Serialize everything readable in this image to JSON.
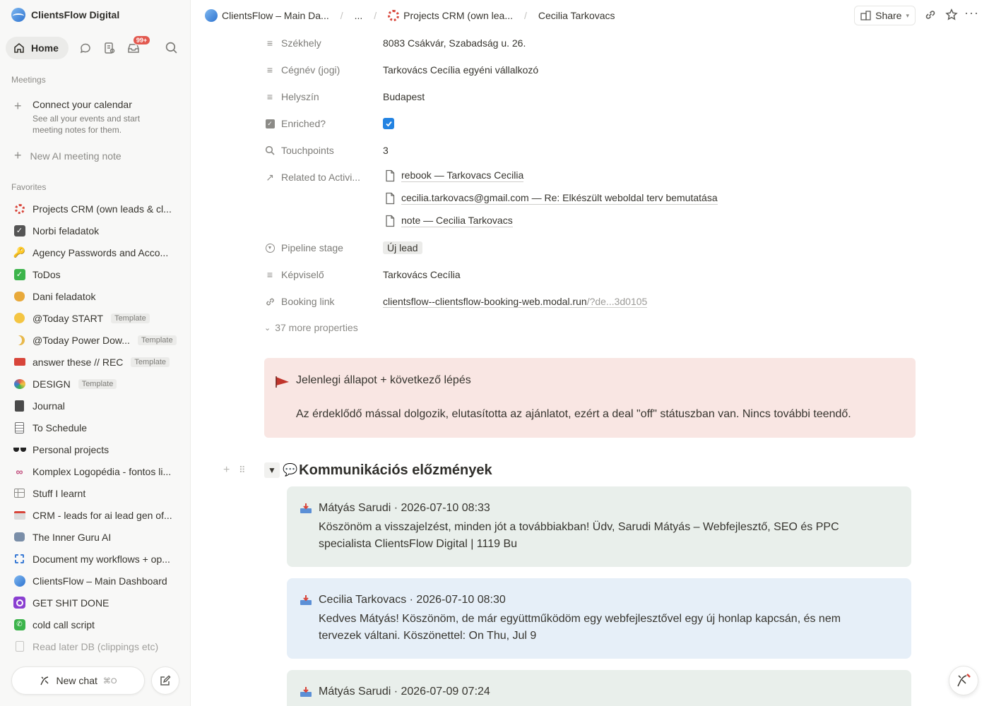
{
  "sidebar": {
    "workspace_name": "ClientsFlow Digital",
    "home_label": "Home",
    "inbox_badge": "99+",
    "meetings_title": "Meetings",
    "connect_calendar_title": "Connect your calendar",
    "connect_calendar_desc": "See all your events and start meeting notes for them.",
    "new_ai_meeting_note": "New AI meeting note",
    "favorites_title": "Favorites",
    "favorites": [
      {
        "label": "Projects CRM (own leads & cl...",
        "icon": "crm-dots-icon"
      },
      {
        "label": "Norbi feladatok",
        "icon": "checkbox-icon"
      },
      {
        "label": "Agency Passwords and Acco...",
        "icon": "key-icon"
      },
      {
        "label": "ToDos",
        "icon": "green-check-icon"
      },
      {
        "label": "Dani feladatok",
        "icon": "cat-icon"
      },
      {
        "label": "@Today START",
        "icon": "smile-icon",
        "template": "Template"
      },
      {
        "label": "@Today Power Dow...",
        "icon": "moon-icon",
        "template": "Template"
      },
      {
        "label": "answer these // REC",
        "icon": "video-camera-icon",
        "template": "Template"
      },
      {
        "label": "DESIGN",
        "icon": "palette-icon",
        "template": "Template"
      },
      {
        "label": "Journal",
        "icon": "notebook-icon"
      },
      {
        "label": "To Schedule",
        "icon": "document-list-icon"
      },
      {
        "label": "Personal projects",
        "icon": "sunglasses-icon"
      },
      {
        "label": "Komplex Logopédia - fontos li...",
        "icon": "link-icon"
      },
      {
        "label": "Stuff I learnt",
        "icon": "table-icon"
      },
      {
        "label": "CRM - leads for ai lead gen of...",
        "icon": "envelope-icon"
      },
      {
        "label": "The Inner Guru AI",
        "icon": "robot-icon"
      },
      {
        "label": "Document my workflows + op...",
        "icon": "chip-icon"
      },
      {
        "label": "ClientsFlow – Main Dashboard",
        "icon": "clientsflow-logo-icon"
      },
      {
        "label": "GET SHIT DONE",
        "icon": "purple-eye-icon"
      },
      {
        "label": "cold call script",
        "icon": "phone-icon"
      },
      {
        "label": "Read later DB (clippings etc)",
        "icon": "clipboard-icon"
      }
    ],
    "new_chat_label": "New chat",
    "new_chat_shortcut": "⌘O"
  },
  "topbar": {
    "breadcrumb_1": "ClientsFlow – Main Da...",
    "breadcrumb_ellipsis": "...",
    "breadcrumb_2": "Projects CRM (own lea...",
    "breadcrumb_3": "Cecilia Tarkovacs",
    "share_label": "Share"
  },
  "properties": {
    "szekhely": {
      "name": "Székhely",
      "value": "8083 Csákvár, Szabadság u. 26."
    },
    "cegnev": {
      "name": "Cégnév (jogi)",
      "value": "Tarkovács Cecília egyéni vállalkozó"
    },
    "helyszin": {
      "name": "Helyszín",
      "value": "Budapest"
    },
    "enriched": {
      "name": "Enriched?",
      "checked": true
    },
    "touchpoints": {
      "name": "Touchpoints",
      "value": "3"
    },
    "related": {
      "name": "Related to Activi...",
      "items": [
        "rebook — Tarkovacs Cecilia",
        "cecilia.tarkovacs@gmail.com — Re: Elkészült weboldal terv bemutatása",
        "note — Cecilia Tarkovacs"
      ]
    },
    "pipeline": {
      "name": "Pipeline stage",
      "value": "Új lead"
    },
    "kepviselo": {
      "name": "Képviselő",
      "value": "Tarkovács Cecília"
    },
    "booking": {
      "name": "Booking link",
      "value": "clientsflow--clientsflow-booking-web.modal.run",
      "value_faded": "/?de...3d0105"
    },
    "more": "37 more properties"
  },
  "callout": {
    "title": "Jelenlegi állapot + következő lépés",
    "body": "Az érdeklődő mással dolgozik, elutasította az ajánlatot, ezért a deal \"off\" státuszban van. Nincs további teendő."
  },
  "history": {
    "heading": "Kommunikációs előzmények",
    "messages": [
      {
        "header": "Mátyás Sarudi · 2026-07-10 08:33",
        "body": "Köszönöm a visszajelzést, minden jót a továbbiakban! Üdv, Sarudi Mátyás – Webfejlesztő, SEO és PPC specialista ClientsFlow Digital | 1119 Bu"
      },
      {
        "header": "Cecilia Tarkovacs · 2026-07-10 08:30",
        "body": "Kedves Mátyás! Köszönöm, de már együttműködöm egy webfejlesztővel egy új honlap kapcsán, és nem tervezek váltani. Köszönettel: On Thu, Jul 9"
      },
      {
        "header": "Mátyás Sarudi · 2026-07-09 07:24",
        "body": ""
      }
    ]
  },
  "colors": {
    "accent_blue": "#2383e2",
    "callout_bg": "#f9e6e3",
    "msg_green_bg": "#e9efeb",
    "msg_blue_bg": "#e6eff8",
    "badge_red": "#e2594f"
  }
}
